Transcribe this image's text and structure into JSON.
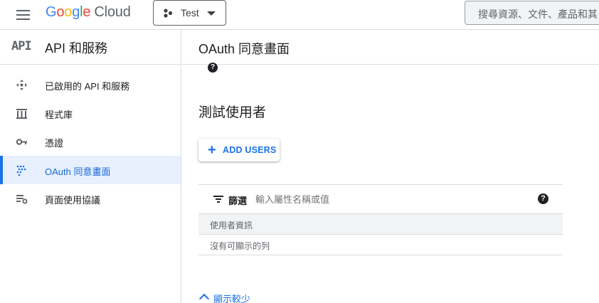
{
  "header": {
    "logo_google": [
      "G",
      "o",
      "o",
      "g",
      "l",
      "e"
    ],
    "logo_cloud": "Cloud",
    "project_name": "Test",
    "search_placeholder": "搜尋資源、文件、產品和其"
  },
  "sidebar": {
    "badge": "API",
    "title": "API 和服務",
    "items": [
      {
        "label": "已啟用的 API 和服務",
        "icon": "api-services-icon"
      },
      {
        "label": "程式庫",
        "icon": "library-icon"
      },
      {
        "label": "憑證",
        "icon": "key-icon"
      },
      {
        "label": "OAuth 同意畫面",
        "icon": "oauth-consent-icon",
        "active": true
      },
      {
        "label": "頁面使用協議",
        "icon": "page-usage-icon"
      }
    ]
  },
  "main": {
    "page_title": "OAuth 同意畫面",
    "help_glyph": "?",
    "section_title": "測試使用者",
    "add_users_label": "ADD USERS",
    "table": {
      "filter_label": "篩選",
      "filter_placeholder": "輸入屬性名稱或值",
      "column_header": "使用者資訊",
      "empty_text": "沒有可顯示的列"
    },
    "show_less_label": "顯示較少"
  },
  "colors": {
    "accent": "#1a73e8",
    "active_bg": "#e8f0fe",
    "border": "#dadce0"
  }
}
